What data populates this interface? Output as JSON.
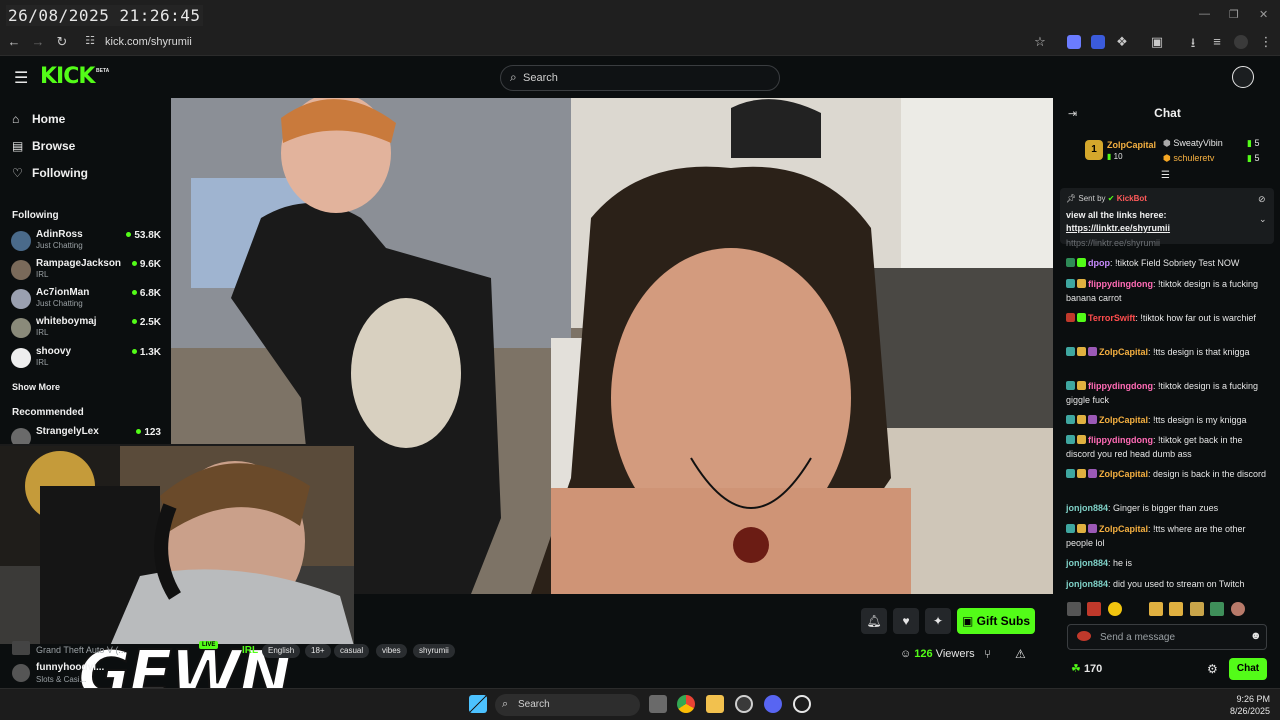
{
  "browser": {
    "overlay_datetime": "26/08/2025 21:26:45",
    "url": "kick.com/shyrumii"
  },
  "header": {
    "logo": "KICK",
    "logo_badge": "BETA",
    "search_placeholder": "Search"
  },
  "sidebar": {
    "nav": [
      {
        "label": "Home",
        "icon": "home-icon"
      },
      {
        "label": "Browse",
        "icon": "browse-icon"
      },
      {
        "label": "Following",
        "icon": "heart-icon"
      }
    ],
    "following_title": "Following",
    "following": [
      {
        "name": "AdinRoss",
        "category": "Just Chatting",
        "viewers": "53.8K",
        "color": "#4a6a8a"
      },
      {
        "name": "RampageJackson",
        "category": "IRL",
        "viewers": "9.6K",
        "color": "#7a6a5a"
      },
      {
        "name": "Ac7ionMan",
        "category": "Just Chatting",
        "viewers": "6.8K",
        "color": "#9aa0b0"
      },
      {
        "name": "whiteboymaj",
        "category": "IRL",
        "viewers": "2.5K",
        "color": "#8a8a7a"
      },
      {
        "name": "shoovy",
        "category": "IRL",
        "viewers": "1.3K",
        "color": "#eeeeee"
      }
    ],
    "show_more": "Show More",
    "recommended_title": "Recommended",
    "recommended": [
      {
        "name": "StrangelyLex",
        "category": "",
        "viewers": "123",
        "color": "#6a6a6a"
      }
    ],
    "below_webcam": [
      {
        "name": "Grand Theft Auto V (...",
        "category": ""
      },
      {
        "name": "funnyhoodvi...",
        "category": "Slots & Casi..."
      }
    ]
  },
  "stream": {
    "live_label": "LIVE",
    "category": "IRL",
    "tags": [
      "English",
      "18+",
      "casual",
      "vibes",
      "shyrumii"
    ],
    "viewers_count": "126",
    "viewers_label": "Viewers",
    "gift_subs_label": "Gift Subs",
    "watermark": "GEWN"
  },
  "chat": {
    "title": "Chat",
    "leaderboard": {
      "top": {
        "rank": "1",
        "name": "ZolpCapital",
        "count": "10"
      },
      "others": [
        {
          "name": "SweatyVibin",
          "count": "5"
        },
        {
          "name": "schuleretv",
          "count": "5"
        }
      ]
    },
    "pinned": {
      "sent_by_label": "Sent by",
      "sender": "KickBot",
      "text": "view all the links heree:",
      "link": "https://linktr.ee/shyrumii",
      "behind_text": "https://linktr.ee/shyrumii"
    },
    "messages": [
      {
        "user": "dpop",
        "color": "#c98bff",
        "text": ": !tiktok Field Sobriety Test NOW"
      },
      {
        "user": "flippydingdong",
        "color": "#ff6bb5",
        "text": ": !tiktok design is a fucking banana carrot"
      },
      {
        "user": "TerrorSwift",
        "color": "#ff4d4d",
        "text": ": !tiktok how far out is warchief"
      },
      {
        "user": "ZolpCapital",
        "color": "#f5b041",
        "text": ": !tts design is that knigga"
      },
      {
        "user": "flippydingdong",
        "color": "#ff6bb5",
        "text": ": !tiktok design is a fucking giggle fuck"
      },
      {
        "user": "ZolpCapital",
        "color": "#f5b041",
        "text": ": !tts design is my knigga"
      },
      {
        "user": "flippydingdong",
        "color": "#ff6bb5",
        "text": ": !tiktok get back in the discord you red head dumb ass"
      },
      {
        "user": "ZolpCapital",
        "color": "#f5b041",
        "text": ": design is back in the discord"
      },
      {
        "user": "jonjon884",
        "color": "#7fd1c7",
        "text": ": Ginger is bigger than zues"
      },
      {
        "user": "ZolpCapital",
        "color": "#f5b041",
        "text": ": !tts where are the other people lol"
      },
      {
        "user": "jonjon884",
        "color": "#7fd1c7",
        "text": ": he is"
      },
      {
        "user": "jonjon884",
        "color": "#7fd1c7",
        "text": ": did you used to stream on Twitch"
      }
    ],
    "input_placeholder": "Send a message",
    "points": "170",
    "send_label": "Chat"
  },
  "taskbar": {
    "search_label": "Search",
    "time": "9:26 PM",
    "date": "8/26/2025"
  },
  "colors": {
    "brand_green": "#53fc18",
    "background": "#0b0e0f"
  }
}
